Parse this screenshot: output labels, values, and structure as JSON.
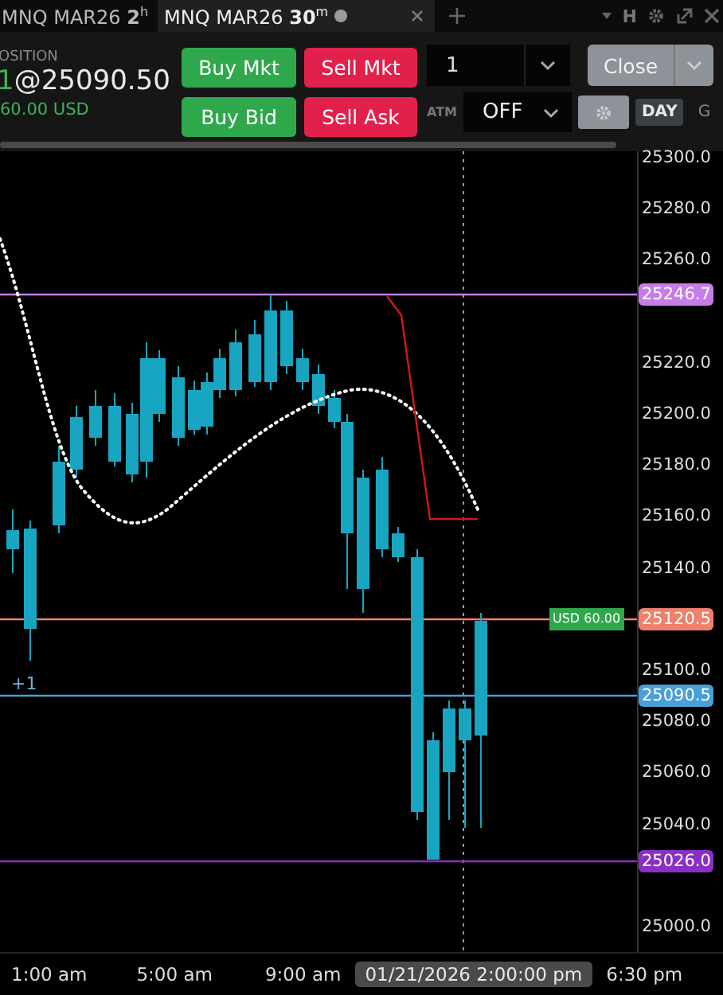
{
  "tabs": [
    {
      "label": "MNQ MAR26 **2**$^{h}$",
      "selected": false,
      "modified": false
    },
    {
      "label": "MNQ MAR26 **30**$^{m}$",
      "selected": true,
      "modified": true
    }
  ],
  "window_controls": [
    {
      "kind": "caret"
    },
    {
      "kind": "text",
      "text": "H"
    },
    {
      "kind": "gear"
    },
    {
      "kind": "popout"
    },
    {
      "kind": "close"
    }
  ],
  "position": {
    "label": "OSITION",
    "quantity": "1",
    "price": "@25090.50",
    "pnl": "60.00 USD"
  },
  "order_buttons": [
    {
      "label": "Buy Mkt",
      "kind": "buy"
    },
    {
      "label": "Sell Mkt",
      "kind": "sell"
    },
    {
      "label": "Buy Bid",
      "kind": "buy"
    },
    {
      "label": "Sell Ask",
      "kind": "sell"
    }
  ],
  "quantity": {
    "value": "1"
  },
  "close_button": {
    "label": "Close"
  },
  "atm": {
    "label": "ATM",
    "value": "OFF"
  },
  "duration": {
    "label": "DAY",
    "next_label": "G"
  },
  "chart": {
    "price_ticks": [
      "25300.0",
      "25280.0",
      "25260.0",
      "25220.0",
      "25200.0",
      "25180.0",
      "25160.0",
      "25140.0",
      "25100.0",
      "25080.0",
      "25060.0",
      "25040.0",
      "25000.0"
    ],
    "price_tags": [
      {
        "text": "25246.7",
        "color": "#c77de8"
      },
      {
        "text": "25120.5",
        "color": "#f0806c"
      },
      {
        "text": "25090.5",
        "color": "#4a9fd8"
      },
      {
        "text": "25026.0",
        "color": "#8a2fc4"
      }
    ],
    "position_tag": "USD 60.00",
    "position_marker": "+1",
    "time_labels": [
      {
        "text": "1:00 am",
        "kind": "tick"
      },
      {
        "text": "5:00 am",
        "kind": "tick"
      },
      {
        "text": "9:00 am",
        "kind": "tick"
      },
      {
        "text": "01/21/2026 2:00:00 pm",
        "kind": "crosshair"
      },
      {
        "text": "6:30 pm",
        "kind": "tick"
      }
    ]
  }
}
